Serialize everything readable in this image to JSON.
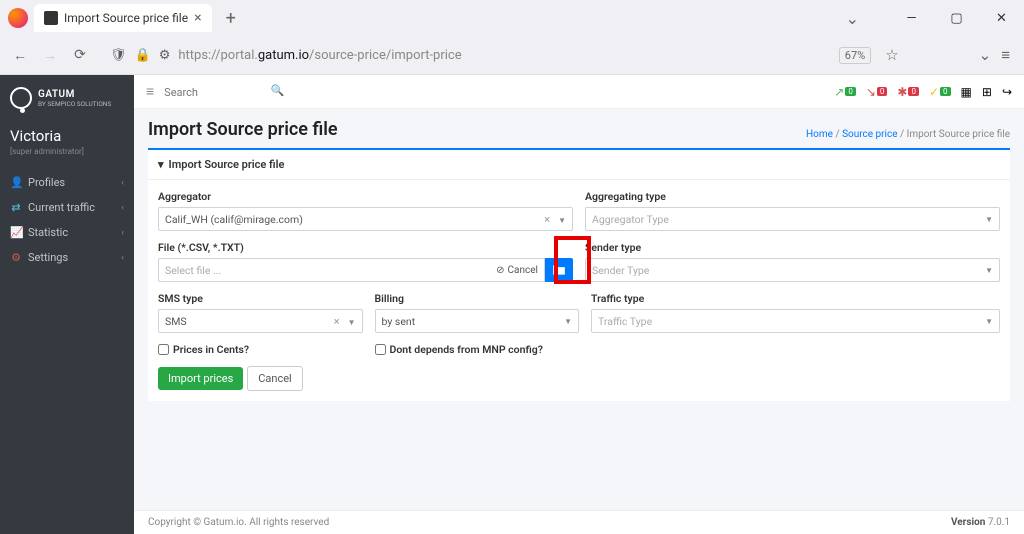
{
  "browser": {
    "tab_title": "Import Source price file",
    "url_prefix": "https://portal.",
    "url_domain": "gatum.io",
    "url_path": "/source-price/import-price",
    "zoom": "67%"
  },
  "sidebar": {
    "brand_line1": "GATUM",
    "brand_line2": "BY SEMPICO SOLUTIONS",
    "user": "Victoria",
    "role": "[super administrator]",
    "items": [
      {
        "icon": "👤",
        "label": "Profiles",
        "color": "#5bc0de"
      },
      {
        "icon": "⇄",
        "label": "Current traffic",
        "color": "#5bc0de"
      },
      {
        "icon": "📈",
        "label": "Statistic",
        "color": "#5cb85c"
      },
      {
        "icon": "⚙",
        "label": "Settings",
        "color": "#d9534f"
      }
    ]
  },
  "topbar": {
    "search_placeholder": "Search",
    "badges": [
      {
        "icon": "↗",
        "value": "0",
        "cls": "",
        "color": "#5cb85c"
      },
      {
        "icon": "↘",
        "value": "0",
        "cls": "red",
        "color": "#d9534f"
      },
      {
        "icon": "✱",
        "value": "0",
        "cls": "red",
        "color": "#d9534f"
      },
      {
        "icon": "✓",
        "value": "0",
        "cls": "yellow",
        "color": "#ffc107"
      }
    ]
  },
  "page": {
    "title": "Import Source price file",
    "crumb_home": "Home",
    "crumb_mid": "Source price",
    "crumb_last": "Import Source price file",
    "card_title": "Import Source price file"
  },
  "form": {
    "aggregator_label": "Aggregator",
    "aggregator_value": "Calif_WH (calif@mirage.com)",
    "aggtype_label": "Aggregating type",
    "aggtype_placeholder": "Aggregator Type",
    "file_label": "File (*.CSV, *.TXT)",
    "file_placeholder": "Select file ...",
    "file_cancel": "Cancel",
    "sender_label": "Sender type",
    "sender_placeholder": "Sender Type",
    "sms_label": "SMS type",
    "sms_value": "SMS",
    "billing_label": "Billing",
    "billing_value": "by sent",
    "traffic_label": "Traffic type",
    "traffic_placeholder": "Traffic Type",
    "cents_label": "Prices in Cents?",
    "mnp_label": "Dont depends from MNP config?",
    "import_btn": "Import prices",
    "cancel_btn": "Cancel"
  },
  "footer": {
    "left": "Copyright © Gatum.io. All rights reserved",
    "right_label": "Version ",
    "right_value": "7.0.1"
  }
}
